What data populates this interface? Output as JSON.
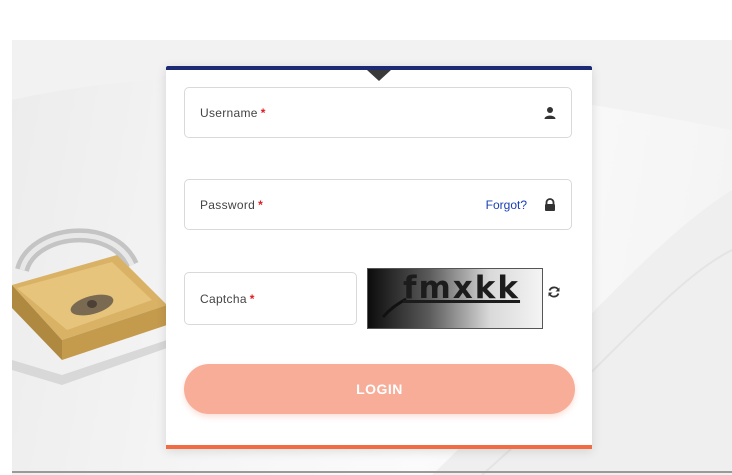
{
  "form": {
    "username": {
      "label": "Username",
      "required_mark": "*",
      "icon": "user-icon"
    },
    "password": {
      "label": "Password",
      "required_mark": "*",
      "forgot_link": "Forgot?",
      "icon": "lock-icon"
    },
    "captcha": {
      "label": "Captcha",
      "required_mark": "*",
      "image_text": "fmxkk",
      "refresh_icon": "refresh-icon"
    },
    "login_button": "LOGIN"
  },
  "colors": {
    "top_accent": "#1b2a73",
    "bottom_accent": "#f26b43",
    "login_button": "#f8ad98",
    "required": "#e01b24",
    "link": "#1a3fb5"
  }
}
